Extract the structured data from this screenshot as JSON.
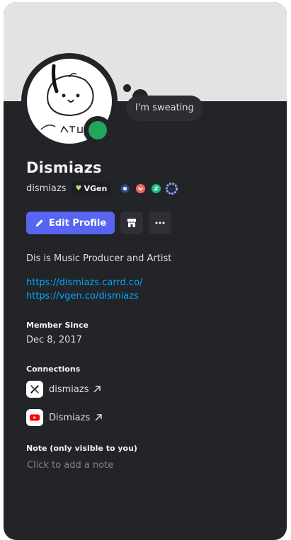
{
  "profile": {
    "display_name": "Dismiazs",
    "username": "dismiazs",
    "custom_status": "I'm sweating",
    "status_color": "#23a55a",
    "banner_color": "#e3e3e3",
    "server_tag": {
      "label": "VGen",
      "icon": "heart-icon"
    },
    "badges": [
      "hypesquad-balance-icon",
      "nitro-icon",
      "quest-badge-icon",
      "originally-known-as-icon",
      "server-boost-icon"
    ],
    "bio": "Dis is Music Producer and Artist",
    "links": [
      "https://dismiazs.carrd.co/",
      "https://vgen.co/dismiazs"
    ]
  },
  "actions": {
    "edit_label": "Edit Profile",
    "edit_icon": "pencil-icon",
    "shop_icon": "shop-icon",
    "more_icon": "more-icon"
  },
  "member_since": {
    "heading": "Member Since",
    "value": "Dec 8, 2017"
  },
  "connections": {
    "heading": "Connections",
    "items": [
      {
        "service": "X",
        "icon": "x-logo-icon",
        "name": "dismiazs"
      },
      {
        "service": "YouTube",
        "icon": "youtube-icon",
        "name": "Dismiazs"
      }
    ]
  },
  "note": {
    "heading": "Note (only visible to you)",
    "placeholder": "Click to add a note"
  },
  "colors": {
    "accent": "#5865f2",
    "link": "#00a8fc",
    "card_bg": "#232428"
  }
}
